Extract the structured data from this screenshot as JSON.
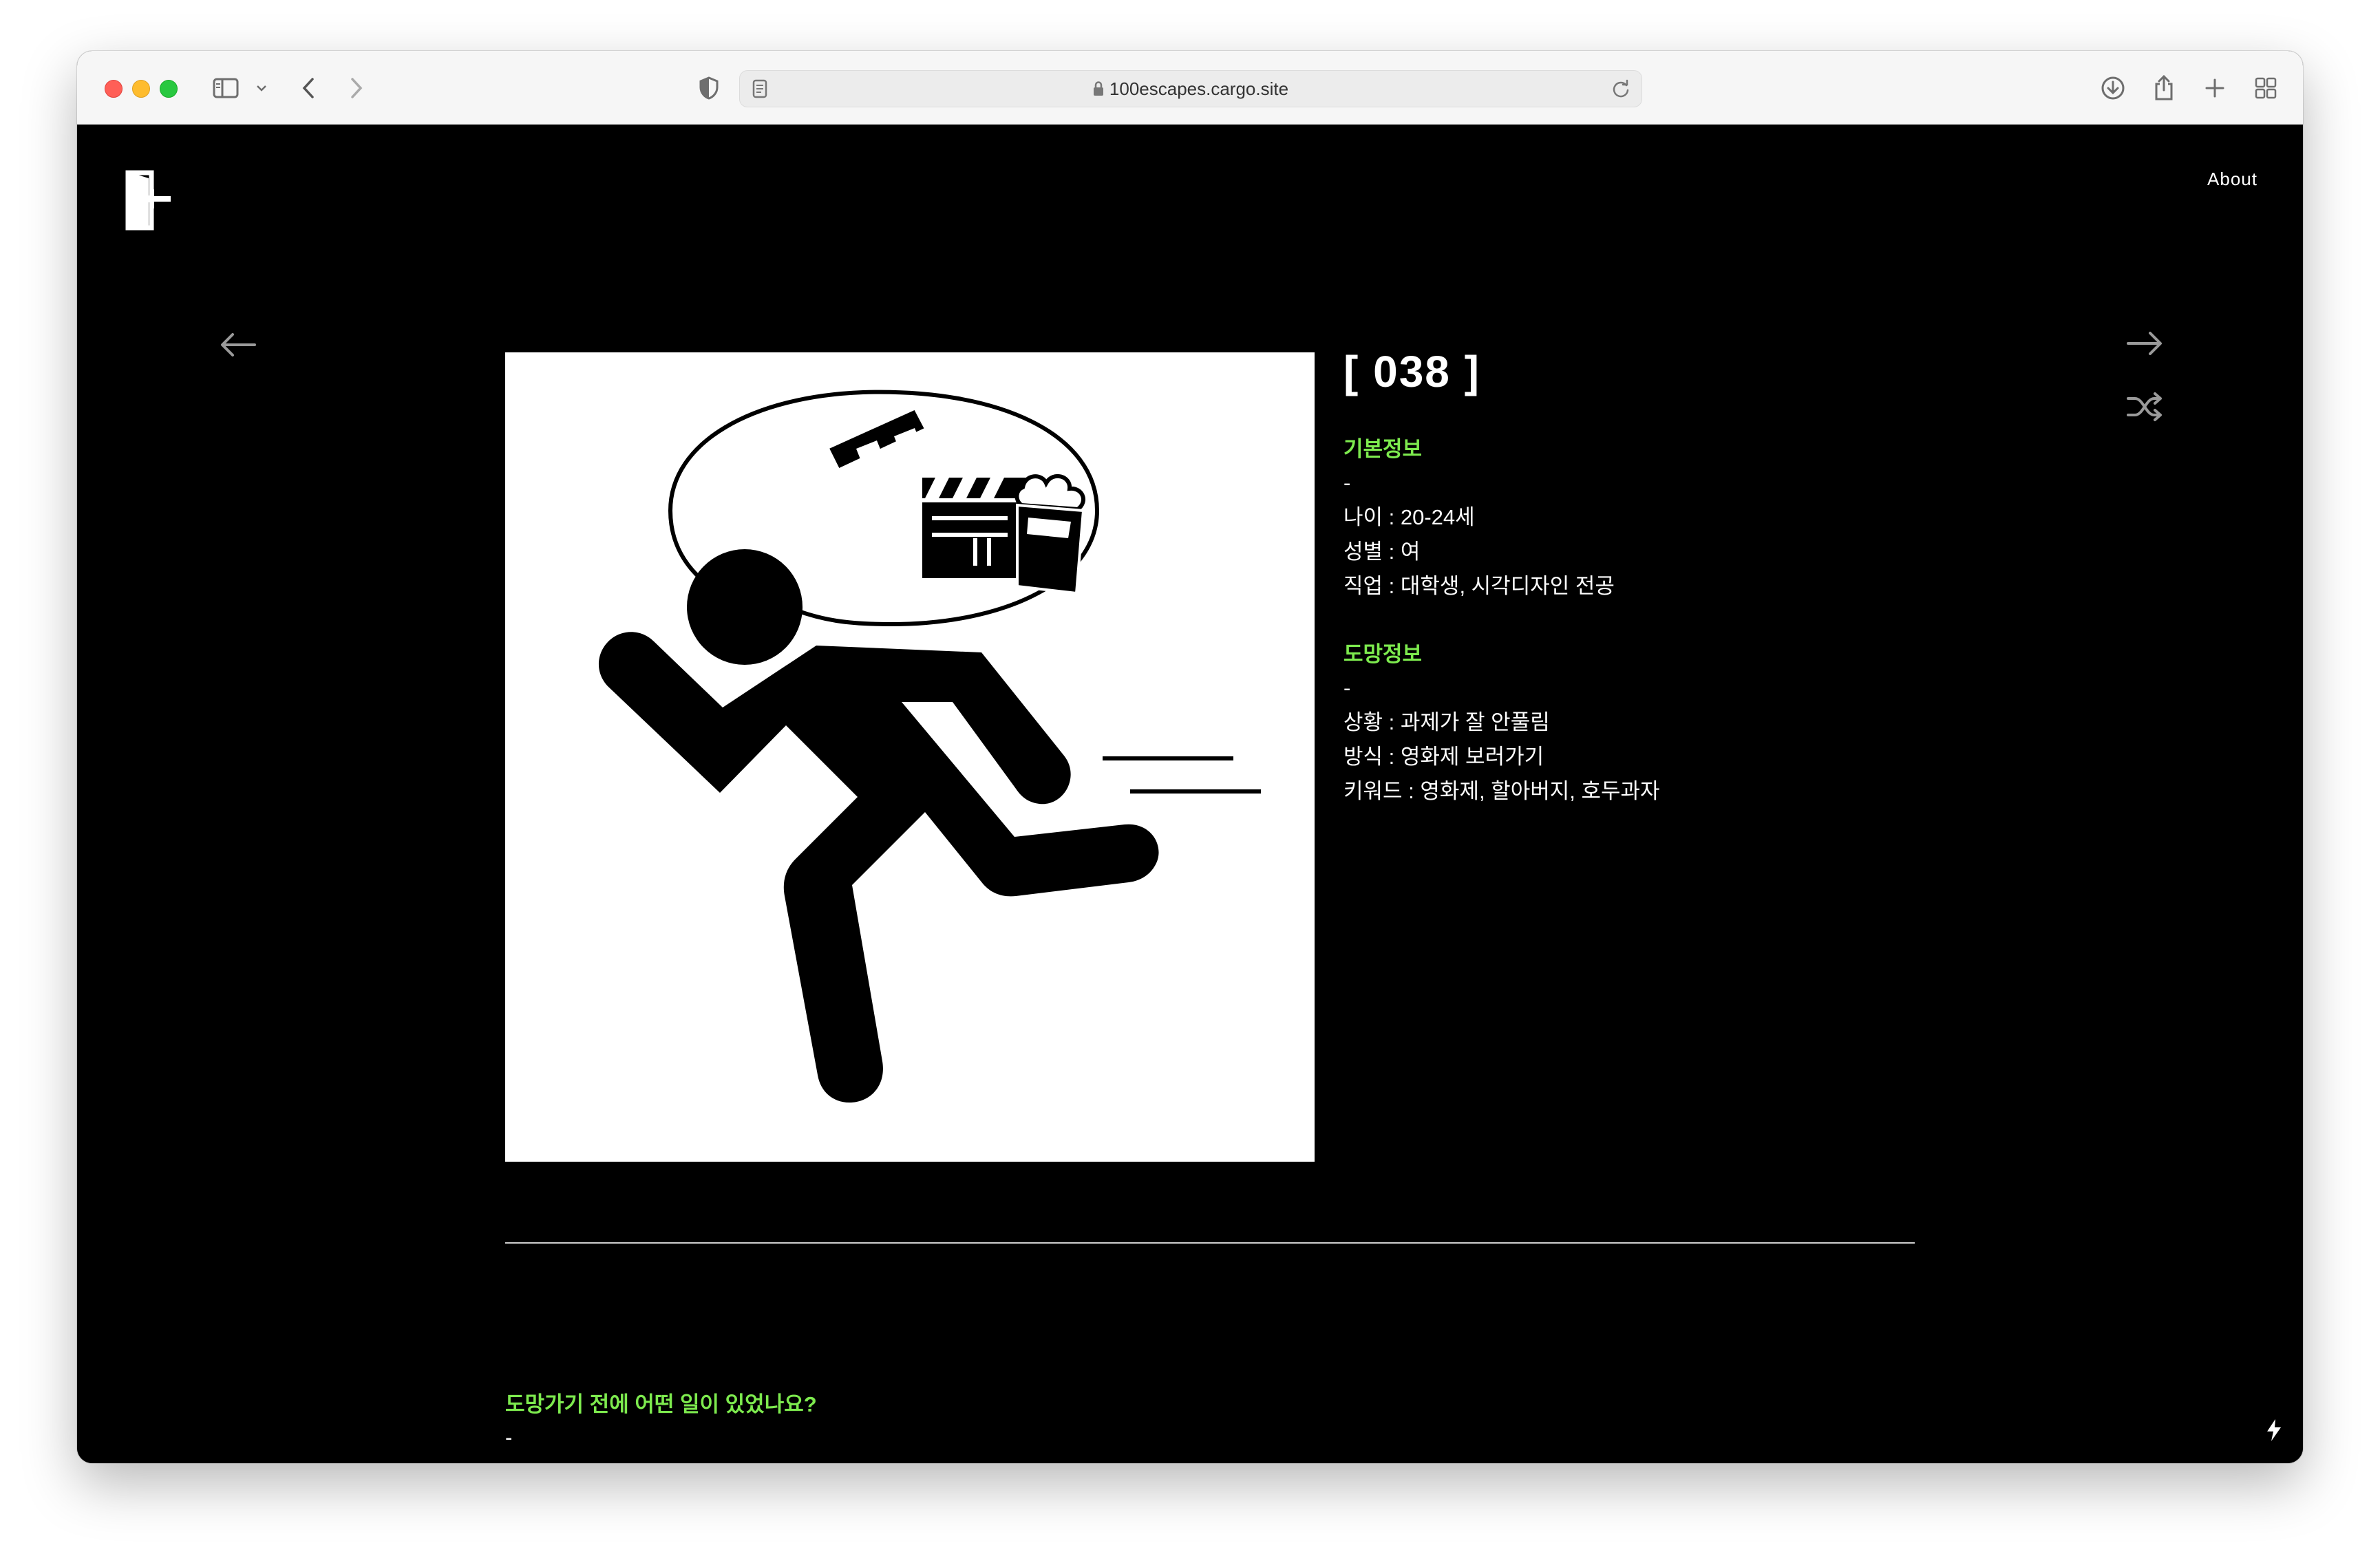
{
  "browser": {
    "url": "100escapes.cargo.site"
  },
  "header": {
    "about_label": "About",
    "logo_icon": "exit-door-icon"
  },
  "navigation": {
    "prev_icon": "arrow-left-icon",
    "next_icon": "arrow-right-icon",
    "shuffle_icon": "shuffle-icon"
  },
  "entry": {
    "number": "[ 038 ]",
    "basic_info": {
      "title": "기본정보",
      "dash": "-",
      "lines": [
        "나이 : 20-24세",
        "성별 : 여",
        "직업 : 대학생, 시각디자인 전공"
      ]
    },
    "escape_info": {
      "title": "도망정보",
      "dash": "-",
      "lines": [
        "상황 : 과제가 잘 안풀림",
        "방식 : 영화제 보러가기",
        "키워드 : 영화제, 할아버지, 호두과자"
      ]
    }
  },
  "story": {
    "question": "도망가기 전에 어떤 일이 있었나요?",
    "answer": "-"
  },
  "colors": {
    "accent_green": "#7dea4e",
    "background": "#000000"
  }
}
